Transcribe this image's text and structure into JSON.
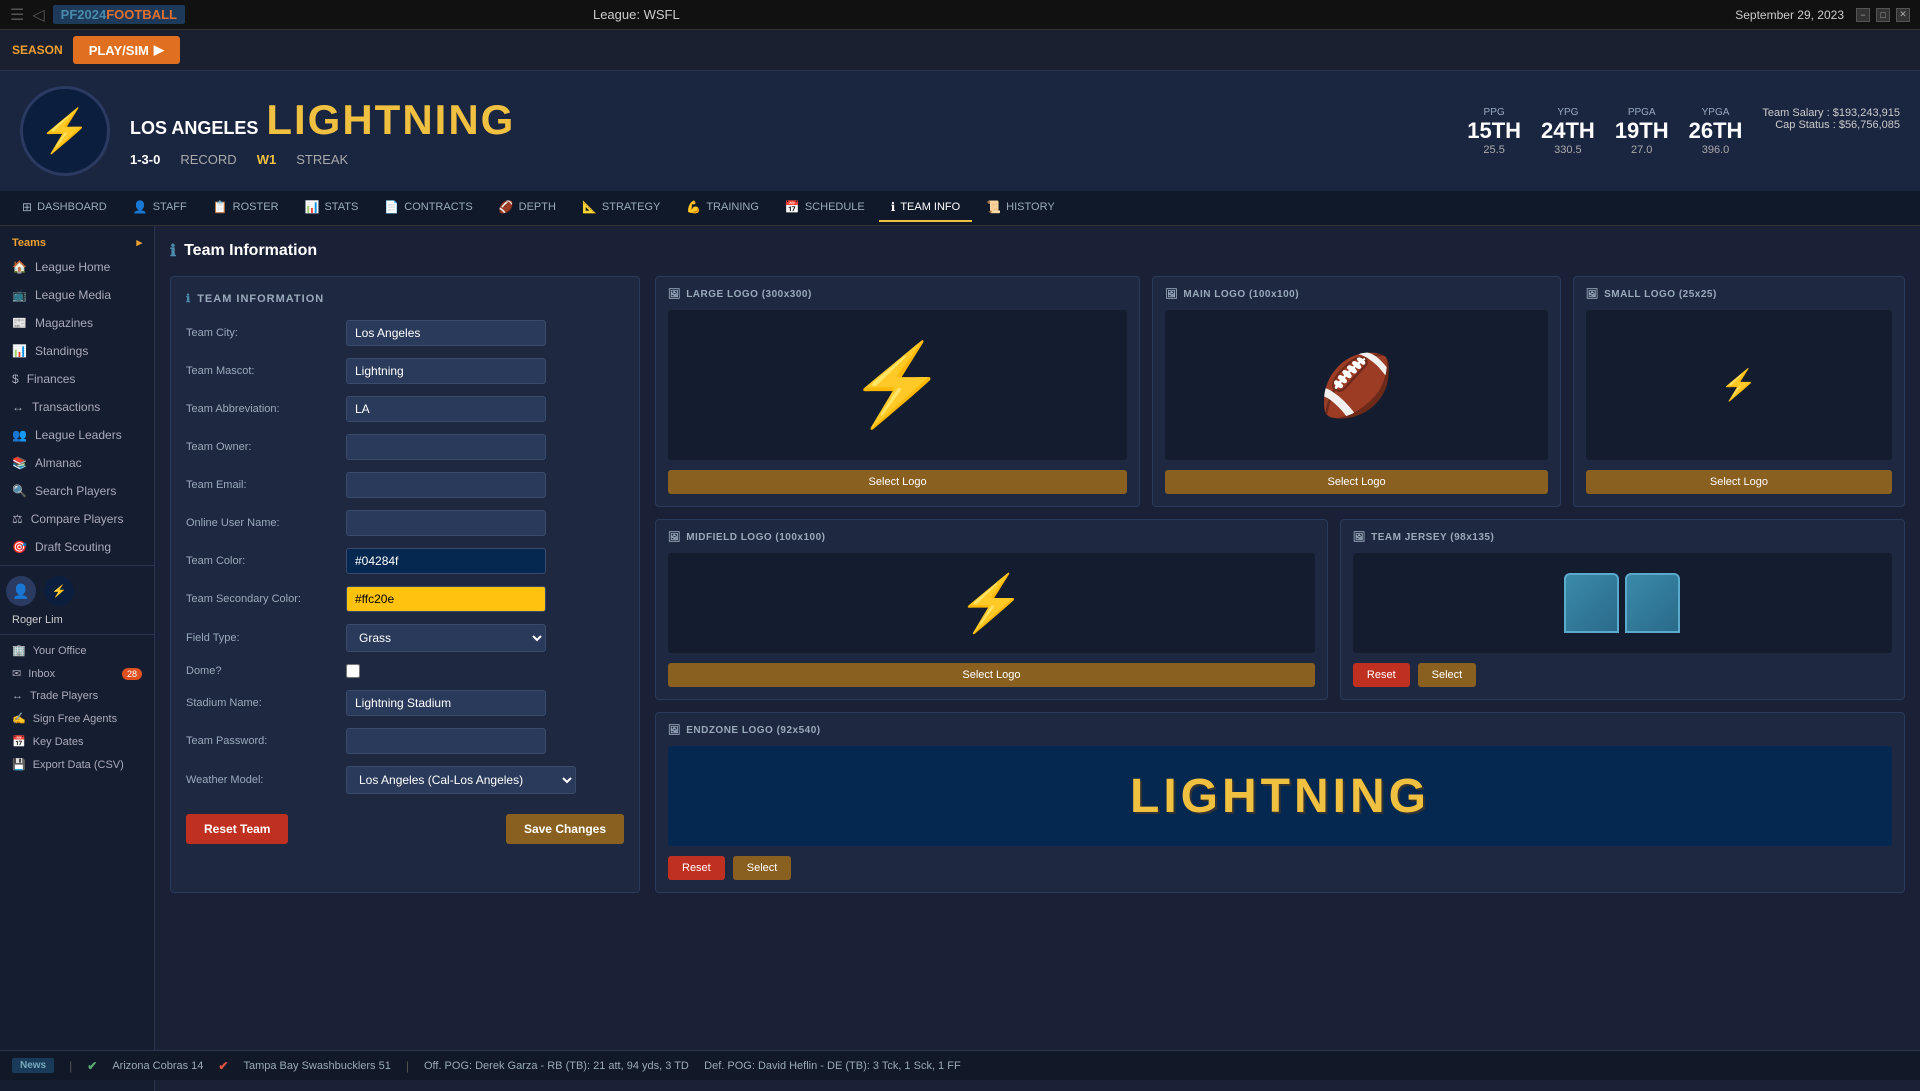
{
  "window": {
    "title": "League: WSFL",
    "date": "September 29, 2023"
  },
  "season": {
    "label": "SEASON",
    "play_sim": "PLAY/SIM"
  },
  "team": {
    "city": "LOS ANGELES",
    "name": "LIGHTNING",
    "record": "1-3-0",
    "record_label": "RECORD",
    "streak": "W1",
    "streak_label": "STREAK"
  },
  "team_stats": {
    "ppg": {
      "label": "PPG",
      "rank": "15TH",
      "val": "25.5"
    },
    "ypg": {
      "label": "YPG",
      "rank": "24TH",
      "val": "330.5"
    },
    "ppga": {
      "label": "PPGA",
      "rank": "19TH",
      "val": "27.0"
    },
    "ypga": {
      "label": "YPGA",
      "rank": "26TH",
      "val": "396.0"
    },
    "salary": "Team Salary : $193,243,915",
    "cap": "Cap Status : $56,756,085"
  },
  "nav_tabs": [
    {
      "id": "dashboard",
      "label": "DASHBOARD",
      "icon": "⊞"
    },
    {
      "id": "staff",
      "label": "STAFF",
      "icon": "👤"
    },
    {
      "id": "roster",
      "label": "ROSTER",
      "icon": "📋"
    },
    {
      "id": "stats",
      "label": "STATS",
      "icon": "📊"
    },
    {
      "id": "contracts",
      "label": "CONTRACTS",
      "icon": "📄"
    },
    {
      "id": "depth",
      "label": "DEPTH",
      "icon": "🏈"
    },
    {
      "id": "strategy",
      "label": "STRATEGY",
      "icon": "📐"
    },
    {
      "id": "training",
      "label": "TRAINING",
      "icon": "💪"
    },
    {
      "id": "schedule",
      "label": "SCHEDULE",
      "icon": "📅"
    },
    {
      "id": "team_info",
      "label": "TEAM INFO",
      "icon": "ℹ"
    },
    {
      "id": "history",
      "label": "HISTORY",
      "icon": "📜"
    }
  ],
  "sidebar": {
    "teams_label": "Teams",
    "nav_items": [
      {
        "id": "league-home",
        "label": "League Home",
        "icon": "🏠"
      },
      {
        "id": "league-media",
        "label": "League Media",
        "icon": "📺"
      },
      {
        "id": "magazines",
        "label": "Magazines",
        "icon": "📰"
      },
      {
        "id": "standings",
        "label": "Standings",
        "icon": "📊"
      },
      {
        "id": "finances",
        "label": "Finances",
        "icon": "💰"
      },
      {
        "id": "transactions",
        "label": "Transactions",
        "icon": "↔"
      },
      {
        "id": "league-leaders",
        "label": "League Leaders",
        "icon": "🏆"
      },
      {
        "id": "almanac",
        "label": "Almanac",
        "icon": "📚"
      },
      {
        "id": "search-players",
        "label": "Search Players",
        "icon": "🔍"
      },
      {
        "id": "compare-players",
        "label": "Compare Players",
        "icon": "⚖"
      },
      {
        "id": "draft-scouting",
        "label": "Draft Scouting",
        "icon": "🎯"
      }
    ],
    "user": {
      "name": "Roger Lim"
    },
    "bottom_links": [
      {
        "id": "your-office",
        "label": "Your Office",
        "icon": "🏢"
      },
      {
        "id": "inbox",
        "label": "Inbox",
        "icon": "✉",
        "badge": "28"
      },
      {
        "id": "trade-players",
        "label": "Trade Players",
        "icon": "↔"
      },
      {
        "id": "sign-free-agents",
        "label": "Sign Free Agents",
        "icon": "✍"
      },
      {
        "id": "key-dates",
        "label": "Key Dates",
        "icon": "📅"
      },
      {
        "id": "export-data",
        "label": "Export Data (CSV)",
        "icon": "💾"
      }
    ]
  },
  "page": {
    "title": "Team Information"
  },
  "form": {
    "header": "TEAM INFORMATION",
    "fields": {
      "team_city_label": "Team City:",
      "team_city_value": "Los Angeles",
      "team_mascot_label": "Team Mascot:",
      "team_mascot_value": "Lightning",
      "team_abbrev_label": "Team Abbreviation:",
      "team_abbrev_value": "LA",
      "team_owner_label": "Team Owner:",
      "team_owner_value": "",
      "team_email_label": "Team Email:",
      "team_email_value": "",
      "online_user_label": "Online User Name:",
      "online_user_value": "",
      "team_color_label": "Team Color:",
      "team_color_value": "#04284f",
      "team_secondary_label": "Team Secondary Color:",
      "team_secondary_value": "#ffc20e",
      "field_type_label": "Field Type:",
      "field_type_value": "Grass",
      "dome_label": "Dome?",
      "stadium_label": "Stadium Name:",
      "stadium_value": "Lightning Stadium",
      "password_label": "Team Password:",
      "password_value": "",
      "weather_label": "Weather Model:",
      "weather_value": "Los Angeles (Cal-Los Angeles)"
    },
    "btn_reset": "Reset Team",
    "btn_save": "Save Changes"
  },
  "logos": {
    "large_logo": {
      "title": "LARGE LOGO (300x300)",
      "btn": "Select Logo"
    },
    "main_logo": {
      "title": "MAIN LOGO (100x100)",
      "btn": "Select Logo"
    },
    "small_logo": {
      "title": "SMALL LOGO (25x25)",
      "btn": "Select Logo"
    },
    "midfield_logo": {
      "title": "MIDFIELD LOGO (100x100)",
      "btn": "Select Logo"
    },
    "team_jersey": {
      "title": "TEAM JERSEY (98x135)",
      "btn_reset": "Reset",
      "btn_select": "Select"
    },
    "endzone_logo": {
      "title": "ENDZONE LOGO (92x540)",
      "text": "LIGHTNING",
      "btn_reset": "Reset",
      "btn_select": "Select"
    }
  },
  "news": {
    "label": "News",
    "ticker": "Arizona Cobras 14  ✔ Tampa Bay Swashbucklers 51    Off. POG: Derek Garza - RB (TB): 21 att, 94 yds, 3 TD    Def. POG: David Heflin - DE (TB): 3 Tck, 1 Sck, 1 FF"
  }
}
